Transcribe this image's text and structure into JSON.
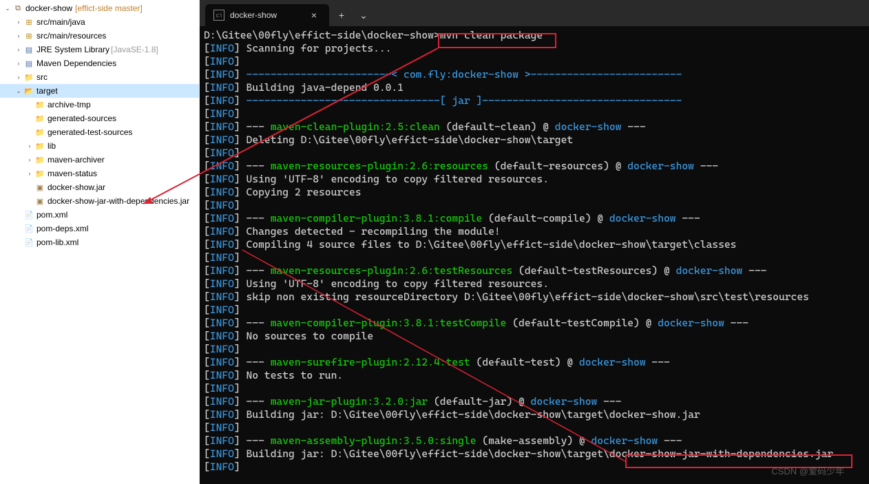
{
  "tree": {
    "project": {
      "name": "docker-show",
      "decorator": "[effict-side master]"
    },
    "items": [
      {
        "label": "docker-show",
        "type": "proj",
        "indent": 0,
        "arrow": "v",
        "suffix": "[effict-side master]"
      },
      {
        "label": "src/main/java",
        "type": "pkg",
        "indent": 1,
        "arrow": ">"
      },
      {
        "label": "src/main/resources",
        "type": "pkg",
        "indent": 1,
        "arrow": ">"
      },
      {
        "label": "JRE System Library",
        "type": "lib",
        "indent": 1,
        "arrow": ">",
        "suffix2": "[JavaSE-1.8]"
      },
      {
        "label": "Maven Dependencies",
        "type": "lib",
        "indent": 1,
        "arrow": ">"
      },
      {
        "label": "src",
        "type": "fold",
        "indent": 1,
        "arrow": ">"
      },
      {
        "label": "target",
        "type": "fold-open",
        "indent": 1,
        "arrow": "v",
        "selected": true
      },
      {
        "label": "archive-tmp",
        "type": "fold",
        "indent": 2,
        "arrow": " "
      },
      {
        "label": "generated-sources",
        "type": "fold",
        "indent": 2,
        "arrow": " "
      },
      {
        "label": "generated-test-sources",
        "type": "fold",
        "indent": 2,
        "arrow": " "
      },
      {
        "label": "lib",
        "type": "fold",
        "indent": 2,
        "arrow": ">"
      },
      {
        "label": "maven-archiver",
        "type": "fold",
        "indent": 2,
        "arrow": ">"
      },
      {
        "label": "maven-status",
        "type": "fold",
        "indent": 2,
        "arrow": ">"
      },
      {
        "label": "docker-show.jar",
        "type": "jar",
        "indent": 2,
        "arrow": " "
      },
      {
        "label": "docker-show-jar-with-dependencies.jar",
        "type": "jar",
        "indent": 2,
        "arrow": " "
      },
      {
        "label": "pom.xml",
        "type": "xml",
        "indent": 1,
        "arrow": " "
      },
      {
        "label": "pom-deps.xml",
        "type": "xml",
        "indent": 1,
        "arrow": " "
      },
      {
        "label": "pom-lib.xml",
        "type": "xml",
        "indent": 1,
        "arrow": " "
      }
    ]
  },
  "tab": {
    "title": "docker-show",
    "close": "×",
    "plus": "+",
    "chevron": "⌄"
  },
  "term": {
    "prompt": "D:\\Gitee\\00fly\\effict-side\\docker-show>",
    "cmd": "mvn clean package",
    "info": "INFO",
    "lines": [
      {
        "segs": [
          [
            "w",
            "Scanning for projects..."
          ]
        ]
      },
      {
        "segs": []
      },
      {
        "segs": [
          [
            "c",
            "------------------------< "
          ],
          [
            "c",
            "com.fly:docker-show"
          ],
          [
            "c",
            " >-------------------------"
          ]
        ]
      },
      {
        "segs": [
          [
            "w",
            "Building java-depend 0.0.1"
          ]
        ]
      },
      {
        "segs": [
          [
            "c",
            "--------------------------------[ jar ]---------------------------------"
          ]
        ]
      },
      {
        "segs": []
      },
      {
        "segs": [
          [
            "w",
            "--- "
          ],
          [
            "g",
            "maven-clean-plugin:2.5:clean"
          ],
          [
            "w",
            " (default-clean) @ "
          ],
          [
            "c",
            "docker-show"
          ],
          [
            "w",
            " ---"
          ]
        ]
      },
      {
        "segs": [
          [
            "w",
            "Deleting D:\\Gitee\\00fly\\effict-side\\docker-show\\target"
          ]
        ]
      },
      {
        "segs": []
      },
      {
        "segs": [
          [
            "w",
            "--- "
          ],
          [
            "g",
            "maven-resources-plugin:2.6:resources"
          ],
          [
            "w",
            " (default-resources) @ "
          ],
          [
            "c",
            "docker-show"
          ],
          [
            "w",
            " ---"
          ]
        ]
      },
      {
        "segs": [
          [
            "w",
            "Using 'UTF-8' encoding to copy filtered resources."
          ]
        ]
      },
      {
        "segs": [
          [
            "w",
            "Copying 2 resources"
          ]
        ]
      },
      {
        "segs": []
      },
      {
        "segs": [
          [
            "w",
            "--- "
          ],
          [
            "g",
            "maven-compiler-plugin:3.8.1:compile"
          ],
          [
            "w",
            " (default-compile) @ "
          ],
          [
            "c",
            "docker-show"
          ],
          [
            "w",
            " ---"
          ]
        ]
      },
      {
        "segs": [
          [
            "w",
            "Changes detected - recompiling the module!"
          ]
        ]
      },
      {
        "segs": [
          [
            "w",
            "Compiling 4 source files to D:\\Gitee\\00fly\\effict-side\\docker-show\\target\\classes"
          ]
        ]
      },
      {
        "segs": []
      },
      {
        "segs": [
          [
            "w",
            "--- "
          ],
          [
            "g",
            "maven-resources-plugin:2.6:testResources"
          ],
          [
            "w",
            " (default-testResources) @ "
          ],
          [
            "c",
            "docker-show"
          ],
          [
            "w",
            " ---"
          ]
        ]
      },
      {
        "segs": [
          [
            "w",
            "Using 'UTF-8' encoding to copy filtered resources."
          ]
        ]
      },
      {
        "segs": [
          [
            "w",
            "skip non existing resourceDirectory D:\\Gitee\\00fly\\effict-side\\docker-show\\src\\test\\resources"
          ]
        ]
      },
      {
        "segs": []
      },
      {
        "segs": [
          [
            "w",
            "--- "
          ],
          [
            "g",
            "maven-compiler-plugin:3.8.1:testCompile"
          ],
          [
            "w",
            " (default-testCompile) @ "
          ],
          [
            "c",
            "docker-show"
          ],
          [
            "w",
            " ---"
          ]
        ]
      },
      {
        "segs": [
          [
            "w",
            "No sources to compile"
          ]
        ]
      },
      {
        "segs": []
      },
      {
        "segs": [
          [
            "w",
            "--- "
          ],
          [
            "g",
            "maven-surefire-plugin:2.12.4:test"
          ],
          [
            "w",
            " (default-test) @ "
          ],
          [
            "c",
            "docker-show"
          ],
          [
            "w",
            " ---"
          ]
        ]
      },
      {
        "segs": [
          [
            "w",
            "No tests to run."
          ]
        ]
      },
      {
        "segs": []
      },
      {
        "segs": [
          [
            "w",
            "--- "
          ],
          [
            "g",
            "maven-jar-plugin:3.2.0:jar"
          ],
          [
            "w",
            " (default-jar) @ "
          ],
          [
            "c",
            "docker-show"
          ],
          [
            "w",
            " ---"
          ]
        ]
      },
      {
        "segs": [
          [
            "w",
            "Building jar: D:\\Gitee\\00fly\\effict-side\\docker-show\\target\\docker-show.jar"
          ]
        ]
      },
      {
        "segs": []
      },
      {
        "segs": [
          [
            "w",
            "--- "
          ],
          [
            "g",
            "maven-assembly-plugin:3.5.0:single"
          ],
          [
            "w",
            " (make-assembly) @ "
          ],
          [
            "c",
            "docker-show"
          ],
          [
            "w",
            " ---"
          ]
        ]
      },
      {
        "segs": [
          [
            "w",
            "Building jar: D:\\Gitee\\00fly\\effict-side\\docker-show\\target\\docker-show-jar-with-dependencies.jar"
          ]
        ]
      },
      {
        "segs": []
      }
    ]
  },
  "watermark": "CSDN @爱码少年"
}
